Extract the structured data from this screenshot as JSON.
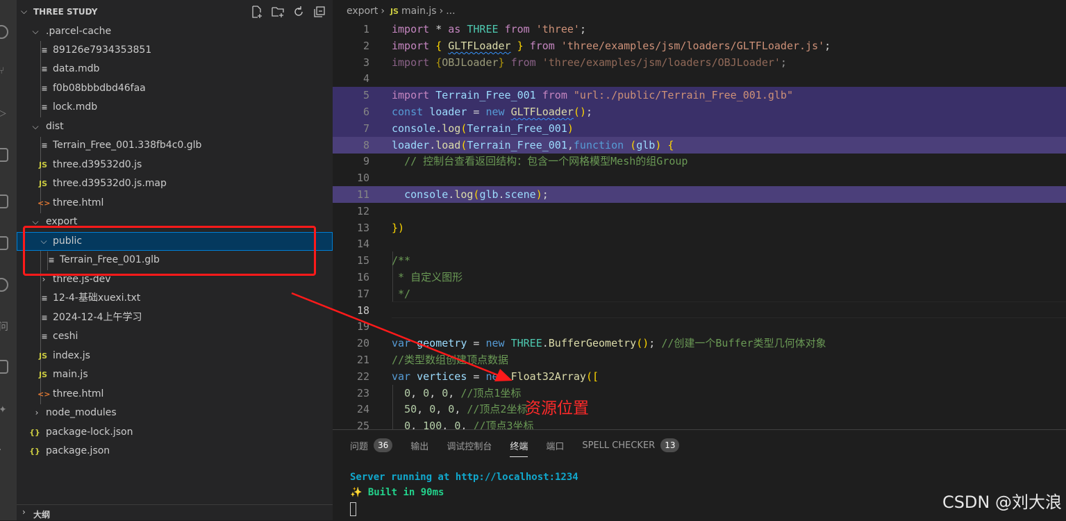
{
  "sidebar": {
    "title": "THREE STUDY",
    "items": [
      {
        "label": ".parcel-cache",
        "type": "folder",
        "state": "open",
        "icon": "chevron-down"
      },
      {
        "label": "89126e7934353851",
        "type": "file",
        "icon": "file-lines"
      },
      {
        "label": "data.mdb",
        "type": "file",
        "icon": "file-lines"
      },
      {
        "label": "f0b08bbbdbd46faa",
        "type": "file",
        "icon": "file-lines"
      },
      {
        "label": "lock.mdb",
        "type": "file",
        "icon": "file-lines"
      },
      {
        "label": "dist",
        "type": "folder",
        "state": "open",
        "icon": "chevron-down"
      },
      {
        "label": "Terrain_Free_001.338fb4c0.glb",
        "type": "file",
        "icon": "file-lines"
      },
      {
        "label": "three.d39532d0.js",
        "type": "file",
        "icon": "js",
        "icon_text": "JS"
      },
      {
        "label": "three.d39532d0.js.map",
        "type": "file",
        "icon": "js",
        "icon_text": "JS"
      },
      {
        "label": "three.html",
        "type": "file",
        "icon": "html",
        "icon_text": "<>"
      },
      {
        "label": "export",
        "type": "folder",
        "state": "open",
        "icon": "chevron-down"
      },
      {
        "label": "public",
        "type": "folder",
        "state": "open",
        "icon": "chevron-down",
        "selected": true
      },
      {
        "label": "Terrain_Free_001.glb",
        "type": "file",
        "icon": "file-lines"
      },
      {
        "label": "three.js-dev",
        "type": "folder",
        "state": "closed",
        "icon": "chevron-right"
      },
      {
        "label": "12-4-基础xuexi.txt",
        "type": "file",
        "icon": "file-lines"
      },
      {
        "label": "2024-12-4上午学习",
        "type": "file",
        "icon": "file-lines"
      },
      {
        "label": "ceshi",
        "type": "file",
        "icon": "file-lines"
      },
      {
        "label": "index.js",
        "type": "file",
        "icon": "js",
        "icon_text": "JS"
      },
      {
        "label": "main.js",
        "type": "file",
        "icon": "js",
        "icon_text": "JS"
      },
      {
        "label": "three.html",
        "type": "file",
        "icon": "html",
        "icon_text": "<>"
      },
      {
        "label": "node_modules",
        "type": "folder",
        "state": "closed",
        "icon": "chevron-right"
      },
      {
        "label": "package-lock.json",
        "type": "file",
        "icon": "json",
        "icon_text": "{}"
      },
      {
        "label": "package.json",
        "type": "file",
        "icon": "json",
        "icon_text": "{}"
      }
    ],
    "outline_label": "大纲"
  },
  "editor": {
    "breadcrumb": {
      "folder": "export",
      "file_icon": "JS",
      "file": "main.js",
      "rest": "..."
    },
    "active_line": 18,
    "lines": [
      {
        "n": "1",
        "text": "import * as THREE from 'three';"
      },
      {
        "n": "2",
        "text": "import { GLTFLoader } from 'three/examples/jsm/loaders/GLTFLoader.js';"
      },
      {
        "n": "3",
        "text": "import {OBJLoader} from 'three/examples/jsm/loaders/OBJLoader';"
      },
      {
        "n": "4",
        "text": ""
      },
      {
        "n": "5",
        "text": "import Terrain_Free_001 from \"url:./public/Terrain_Free_001.glb\""
      },
      {
        "n": "6",
        "text": "const loader = new GLTFLoader();"
      },
      {
        "n": "7",
        "text": "console.log(Terrain_Free_001)"
      },
      {
        "n": "8",
        "text": "loader.load(Terrain_Free_001,function (glb) {"
      },
      {
        "n": "9",
        "text": "  // 控制台查看返回结构：包含一个网格模型Mesh的组Group"
      },
      {
        "n": "10",
        "text": ""
      },
      {
        "n": "11",
        "text": "  console.log(glb.scene);"
      },
      {
        "n": "12",
        "text": ""
      },
      {
        "n": "13",
        "text": "})"
      },
      {
        "n": "14",
        "text": ""
      },
      {
        "n": "15",
        "text": "/**"
      },
      {
        "n": "16",
        "text": " * 自定义图形"
      },
      {
        "n": "17",
        "text": " */"
      },
      {
        "n": "18",
        "text": ""
      },
      {
        "n": "19",
        "text": ""
      },
      {
        "n": "20",
        "text": "var geometry = new THREE.BufferGeometry(); //创建一个Buffer类型几何体对象"
      },
      {
        "n": "21",
        "text": "//类型数组创建顶点数据"
      },
      {
        "n": "22",
        "text": "var vertices = new Float32Array(["
      },
      {
        "n": "23",
        "text": "  0, 0, 0, //顶点1坐标"
      },
      {
        "n": "24",
        "text": "  50, 0, 0, //顶点2坐标"
      },
      {
        "n": "25",
        "text": "  0, 100, 0, //顶点3坐标"
      }
    ]
  },
  "panel": {
    "tabs": [
      {
        "label": "问题",
        "badge": "36"
      },
      {
        "label": "输出"
      },
      {
        "label": "调试控制台"
      },
      {
        "label": "终端",
        "active": true
      },
      {
        "label": "端口"
      },
      {
        "label": "SPELL CHECKER",
        "badge": "13"
      }
    ],
    "terminal": {
      "line1_prefix": "Server running at ",
      "line1_url": "http://localhost:1234",
      "line2_icon": "✨",
      "line2_text": " Built in 90ms"
    }
  },
  "annotation": {
    "label": "资源位置",
    "color": "#ff1a1a"
  },
  "watermark": "CSDN @刘大浪"
}
